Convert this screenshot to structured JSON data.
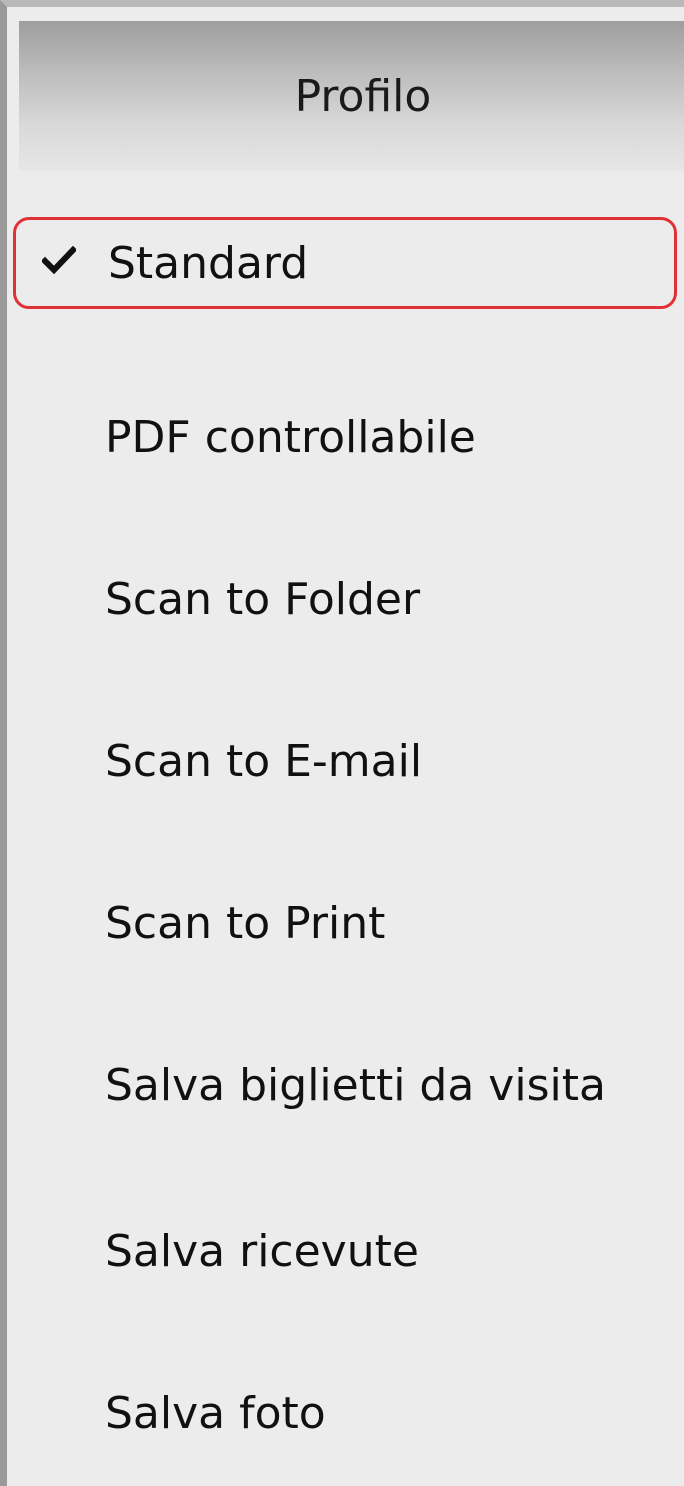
{
  "header": {
    "title": "Profilo"
  },
  "menu": {
    "items": [
      {
        "label": "Standard",
        "checked": true
      },
      {
        "label": "PDF controllabile",
        "checked": false
      },
      {
        "label": "Scan to Folder",
        "checked": false
      },
      {
        "label": "Scan to E-mail",
        "checked": false
      },
      {
        "label": "Scan to Print",
        "checked": false
      },
      {
        "label": "Salva biglietti da visita",
        "checked": false
      },
      {
        "label": "Salva ricevute",
        "checked": false
      },
      {
        "label": "Salva foto",
        "checked": false
      }
    ]
  },
  "colors": {
    "highlight_border": "#e03236",
    "panel_background": "#ececec",
    "header_gradient_top": "#9e9e9e",
    "header_gradient_bottom": "#e6e6e6"
  },
  "icons": {
    "checkmark": "checkmark-icon"
  }
}
